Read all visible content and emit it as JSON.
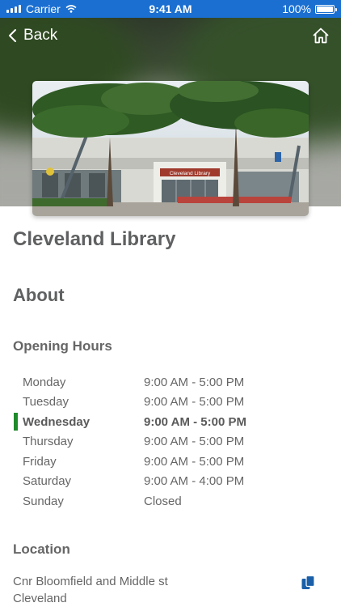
{
  "status_bar": {
    "carrier": "Carrier",
    "time": "9:41 AM",
    "battery": "100%",
    "color": "#1a6fd1"
  },
  "nav": {
    "back_label": "Back",
    "back_icon": "chevron-left-icon",
    "home_icon": "home-icon"
  },
  "library": {
    "name": "Cleveland Library",
    "photo_sign": "Cleveland Library"
  },
  "about": {
    "heading": "About"
  },
  "opening_hours": {
    "heading": "Opening Hours",
    "today_color": "#1e8a2a",
    "rows": [
      {
        "day": "Monday",
        "hours": "9:00 AM - 5:00 PM",
        "today": false
      },
      {
        "day": "Tuesday",
        "hours": "9:00 AM - 5:00 PM",
        "today": false
      },
      {
        "day": "Wednesday",
        "hours": "9:00 AM - 5:00 PM",
        "today": true
      },
      {
        "day": "Thursday",
        "hours": "9:00 AM - 5:00 PM",
        "today": false
      },
      {
        "day": "Friday",
        "hours": "9:00 AM - 5:00 PM",
        "today": false
      },
      {
        "day": "Saturday",
        "hours": "9:00 AM - 4:00 PM",
        "today": false
      },
      {
        "day": "Sunday",
        "hours": "Closed",
        "today": false
      }
    ]
  },
  "location": {
    "heading": "Location",
    "address_line1": "Cnr Bloomfield and Middle st",
    "address_line2": "Cleveland",
    "copy_icon": "copy-icon",
    "copy_icon_color": "#1a5fa8"
  }
}
